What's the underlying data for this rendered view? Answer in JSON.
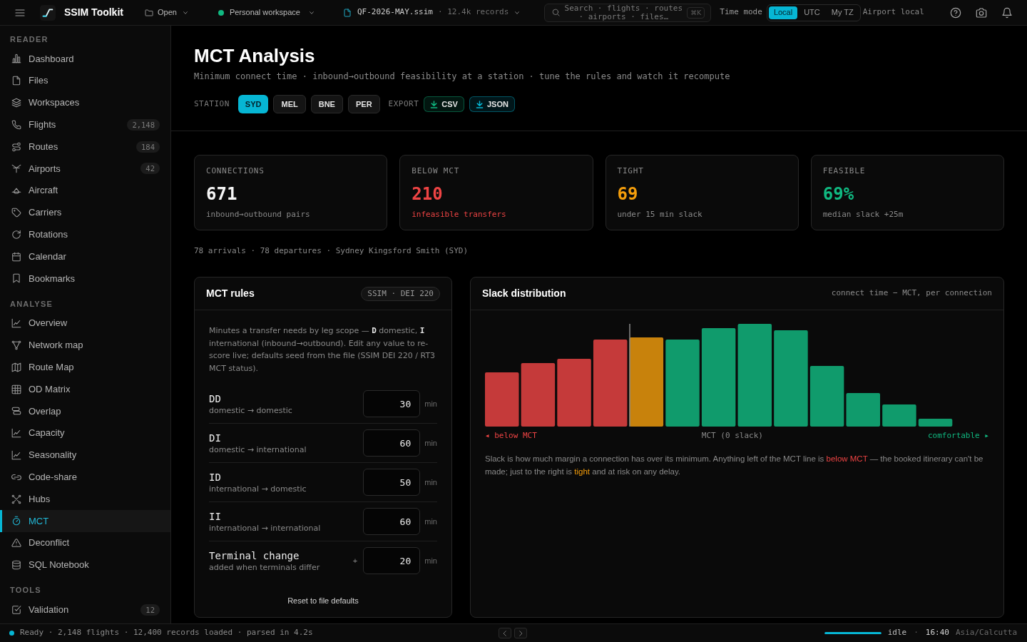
{
  "topbar": {
    "app_name": "SSIM Toolkit",
    "open": {
      "label": "Open"
    },
    "workspace": {
      "label": "Personal workspace"
    },
    "file": {
      "name": "QF-2026-MAY.ssim",
      "meta": "· 12.4k records"
    },
    "search": {
      "placeholder": "Search · flights · routes · airports · files…",
      "shortcut": "⌘K"
    },
    "time_mode": {
      "label": "Time mode",
      "options": [
        {
          "label": "Local",
          "selected": true
        },
        {
          "label": "UTC",
          "selected": false
        },
        {
          "label": "My TZ",
          "selected": false
        }
      ],
      "note": "Airport local"
    }
  },
  "sidebar": {
    "sections": [
      {
        "title": "READER",
        "items": [
          {
            "label": "Dashboard",
            "selected": false
          },
          {
            "label": "Files",
            "selected": false
          },
          {
            "label": "Workspaces",
            "selected": false
          },
          {
            "label": "Flights",
            "count": "2,148",
            "selected": false
          },
          {
            "label": "Routes",
            "count": "184",
            "selected": false
          },
          {
            "label": "Airports",
            "count": "42",
            "selected": false
          },
          {
            "label": "Aircraft",
            "selected": false
          },
          {
            "label": "Carriers",
            "selected": false
          },
          {
            "label": "Rotations",
            "selected": false
          },
          {
            "label": "Calendar",
            "selected": false
          },
          {
            "label": "Bookmarks",
            "selected": false
          }
        ]
      },
      {
        "title": "ANALYSE",
        "items": [
          {
            "label": "Overview",
            "selected": false
          },
          {
            "label": "Network map",
            "selected": false
          },
          {
            "label": "Route Map",
            "selected": false
          },
          {
            "label": "OD Matrix",
            "selected": false
          },
          {
            "label": "Overlap",
            "selected": false
          },
          {
            "label": "Capacity",
            "selected": false
          },
          {
            "label": "Seasonality",
            "selected": false
          },
          {
            "label": "Code-share",
            "selected": false
          },
          {
            "label": "Hubs",
            "selected": false
          },
          {
            "label": "MCT",
            "selected": true
          },
          {
            "label": "Deconflict",
            "selected": false
          },
          {
            "label": "SQL Notebook",
            "selected": false
          }
        ]
      },
      {
        "title": "TOOLS",
        "items": [
          {
            "label": "Validation",
            "count": "12",
            "selected": false
          }
        ]
      }
    ]
  },
  "page": {
    "title": "MCT Analysis",
    "subtitle": "Minimum connect time · inbound→outbound feasibility at a station · tune the rules and watch it recompute",
    "station_label": "STATION",
    "stations": [
      {
        "label": "SYD",
        "selected": true
      },
      {
        "label": "MEL",
        "selected": false
      },
      {
        "label": "BNE",
        "selected": false
      },
      {
        "label": "PER",
        "selected": false
      }
    ],
    "export_label": "EXPORT",
    "exports": [
      {
        "label": "CSV",
        "color": "#10b981"
      },
      {
        "label": "JSON",
        "color": "#06b6d4"
      }
    ]
  },
  "stats": [
    {
      "label": "CONNECTIONS",
      "value": "671",
      "note": "inbound→outbound pairs",
      "color": "#f5f5f5",
      "note_colored": false
    },
    {
      "label": "BELOW MCT",
      "value": "210",
      "note": "infeasible transfers",
      "color": "#ef4444",
      "note_colored": true
    },
    {
      "label": "TIGHT",
      "value": "69",
      "note": "under 15 min slack",
      "color": "#f59e0b",
      "note_colored": false
    },
    {
      "label": "FEASIBLE",
      "value": "69%",
      "note": "median slack +25m",
      "color": "#10b981",
      "note_colored": false
    }
  ],
  "summary": "78 arrivals · 78 departures · Sydney Kingsford Smith (SYD)",
  "rules_panel": {
    "title": "MCT rules",
    "badge": "SSIM · DEI 220",
    "description": "Minutes a transfer needs by leg scope — **D** domestic, **I** international (inbound→outbound). Edit any value to re-score live; defaults seed from the file (SSIM DEI 220 / RT3 MCT status).",
    "rules": [
      {
        "code": "DD",
        "description": "domestic → domestic",
        "value": "30",
        "unit": "min"
      },
      {
        "code": "DI",
        "description": "domestic → international",
        "value": "60",
        "unit": "min"
      },
      {
        "code": "ID",
        "description": "international → domestic",
        "value": "50",
        "unit": "min"
      },
      {
        "code": "II",
        "description": "international → international",
        "value": "60",
        "unit": "min"
      },
      {
        "code": "Terminal change",
        "description": "added when terminals differ",
        "prefix": "+",
        "value": "20",
        "unit": "min"
      }
    ],
    "reset": "Reset to file defaults"
  },
  "chart_panel": {
    "title": "Slack distribution",
    "caption": "connect time − MCT, per connection",
    "axis_labels": {
      "left": "◂ below MCT",
      "center": "MCT (0 slack)",
      "right": "comfortable ▸"
    },
    "explanation": [
      {
        "text": "Slack is how much margin a connection has over its minimum. Anything left of the MCT line is ",
        "kind": "plain"
      },
      {
        "text": "below MCT",
        "kind": "danger"
      },
      {
        "text": " — the booked itinerary can't be made; just to the right is ",
        "kind": "plain"
      },
      {
        "text": "tight",
        "kind": "warning"
      },
      {
        "text": " and at risk on any delay.",
        "kind": "plain"
      }
    ]
  },
  "status_bar": {
    "summary": "Ready · 2,148 flights · 12,400 records loaded · parsed in 4.2s",
    "progress": {
      "level": 1
    },
    "state": "idle",
    "separator": "·",
    "time": "16:40",
    "timezone": "Asia/Calcutta"
  }
}
